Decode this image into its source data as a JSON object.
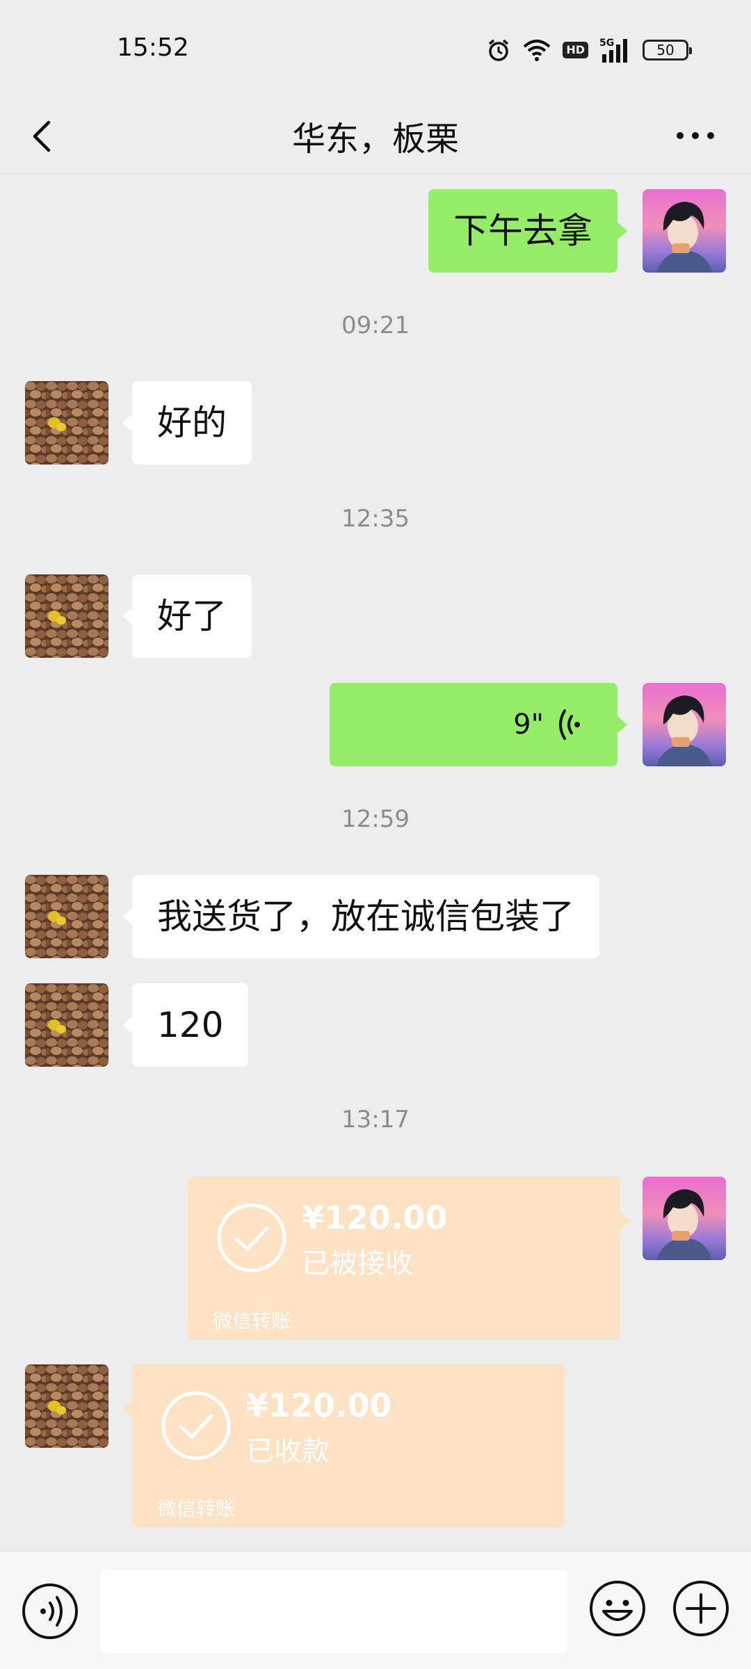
{
  "status_bar": {
    "time": "15:52",
    "network": "5G",
    "hd_badge": "HD",
    "battery": "50",
    "icons": [
      "alarm-icon",
      "wifi-icon",
      "hd-icon",
      "signal-5g-icon",
      "battery-icon"
    ]
  },
  "header": {
    "title": "华东，板栗",
    "back_icon": "chevron-left-icon",
    "more_icon": "more-horizontal-icon"
  },
  "messages": [
    {
      "type": "text",
      "sender": "me",
      "text": "下午去拿"
    },
    {
      "type": "timestamp",
      "text": "09:21"
    },
    {
      "type": "text",
      "sender": "them",
      "text": "好的"
    },
    {
      "type": "timestamp",
      "text": "12:35"
    },
    {
      "type": "text",
      "sender": "them",
      "text": "好了"
    },
    {
      "type": "voice",
      "sender": "me",
      "duration": "9\""
    },
    {
      "type": "timestamp",
      "text": "12:59"
    },
    {
      "type": "text",
      "sender": "them",
      "text": "我送货了，放在诚信包装了"
    },
    {
      "type": "text",
      "sender": "them",
      "text": "120"
    },
    {
      "type": "timestamp",
      "text": "13:17"
    },
    {
      "type": "transfer",
      "sender": "me",
      "amount": "¥120.00",
      "status": "已被接收",
      "source": "微信转账"
    },
    {
      "type": "transfer",
      "sender": "them",
      "amount": "¥120.00",
      "status": "已收款",
      "source": "微信转账"
    }
  ],
  "input_bar": {
    "placeholder": "",
    "voice_icon": "voice-input-icon",
    "emoji_icon": "emoji-icon",
    "plus_icon": "plus-icon"
  },
  "colors": {
    "background": "#ededed",
    "my_bubble": "#95ec69",
    "their_bubble": "#ffffff",
    "transfer_card": "#fde2c4",
    "timestamp": "#8c8c8c"
  }
}
